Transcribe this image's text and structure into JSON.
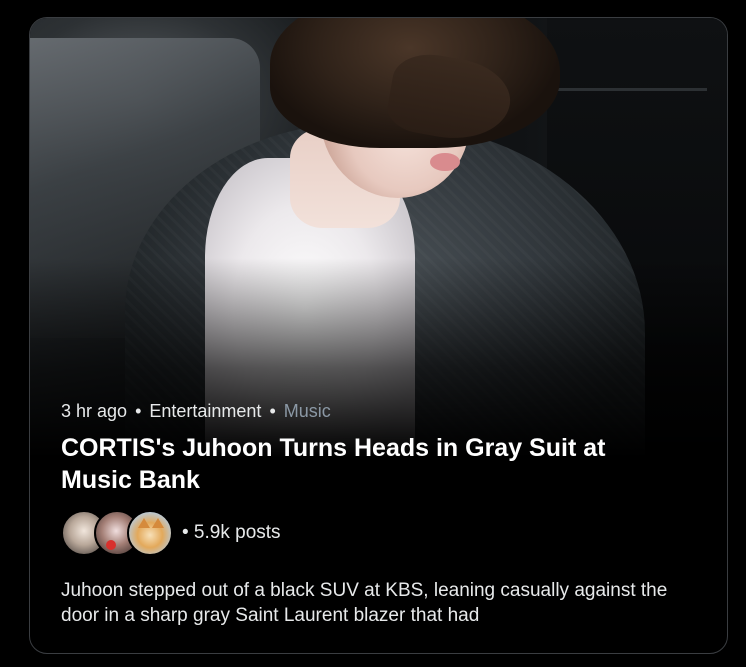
{
  "trend_card": {
    "time_ago": "3 hr ago",
    "category": "Entertainment",
    "subcategory": "Music",
    "headline": "CORTIS's Juhoon Turns Heads in Gray Suit at Music Bank",
    "posts_count": "• 5.9k posts",
    "summary": "Juhoon stepped out of a black SUV at KBS, leaning casually against the door in a sharp gray Saint Laurent blazer that had",
    "hero_image_alt": "Person in gray suit and white shirt stepping out of a black car",
    "colors": {
      "background": "#000000",
      "text_primary": "#e7e9ea",
      "text_muted": "#8b98a5",
      "border": "#3a3d41"
    }
  }
}
